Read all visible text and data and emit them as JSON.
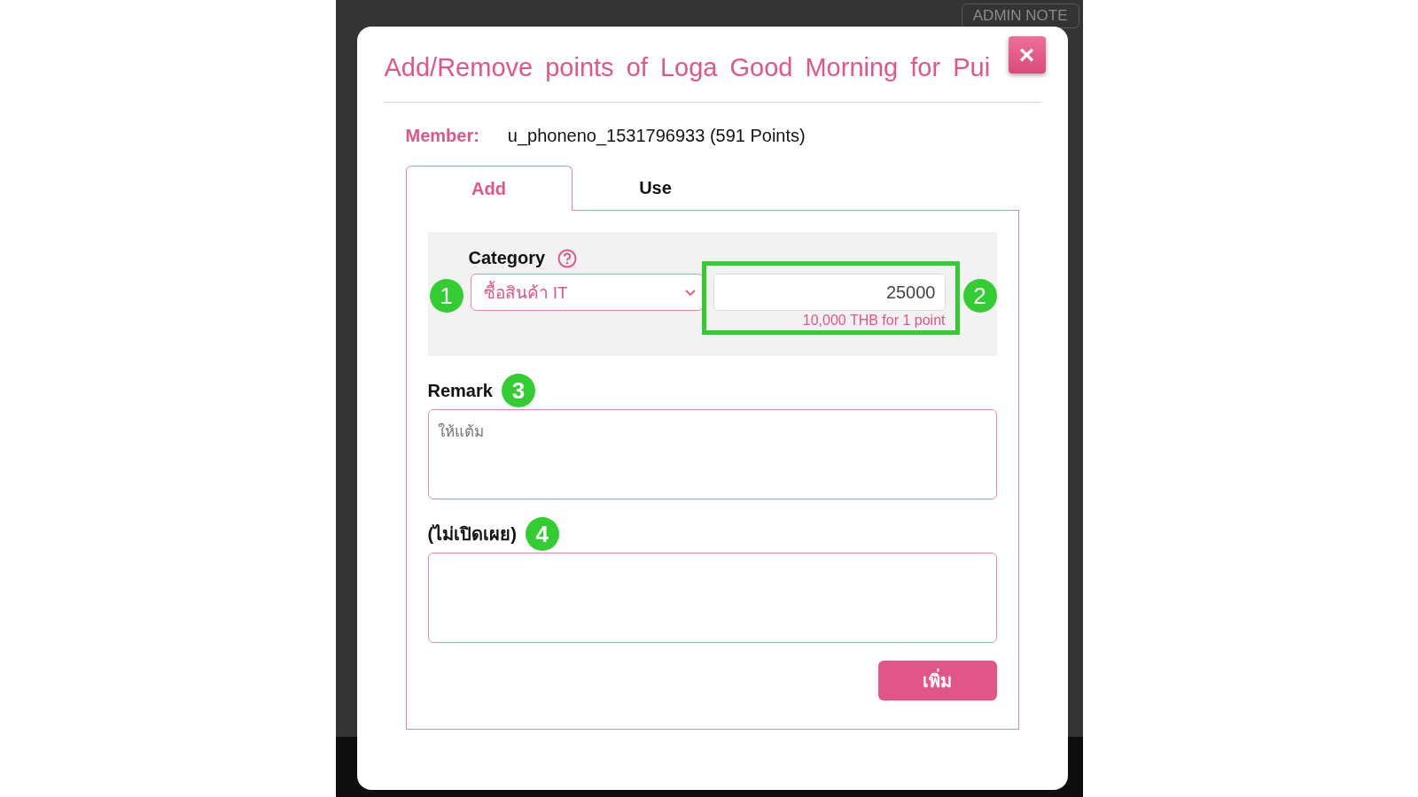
{
  "background_page": {
    "admin_note_button": "ADMIN NOTE"
  },
  "dialog": {
    "title": "Add/Remove points of Loga Good Morning for Pui",
    "close_label": "×",
    "member": {
      "label": "Member:",
      "value": "u_phoneno_1531796933 (591 Points)"
    },
    "tabs": [
      {
        "label": "Add",
        "selected": true
      },
      {
        "label": "Use",
        "selected": false
      }
    ],
    "category": {
      "label": "Category",
      "select_value": "ซื้อสินค้า IT",
      "amount_value": "25000",
      "hint": "10,000 THB for 1 point"
    },
    "remark": {
      "label": "Remark",
      "placeholder": "ให้แต้ม"
    },
    "private_note": {
      "label": "(ไม่เปิดเผย)"
    },
    "submit_button": "เพิ่ม"
  },
  "annotations": [
    {
      "number": "1"
    },
    {
      "number": "2"
    },
    {
      "number": "3"
    },
    {
      "number": "4"
    }
  ]
}
